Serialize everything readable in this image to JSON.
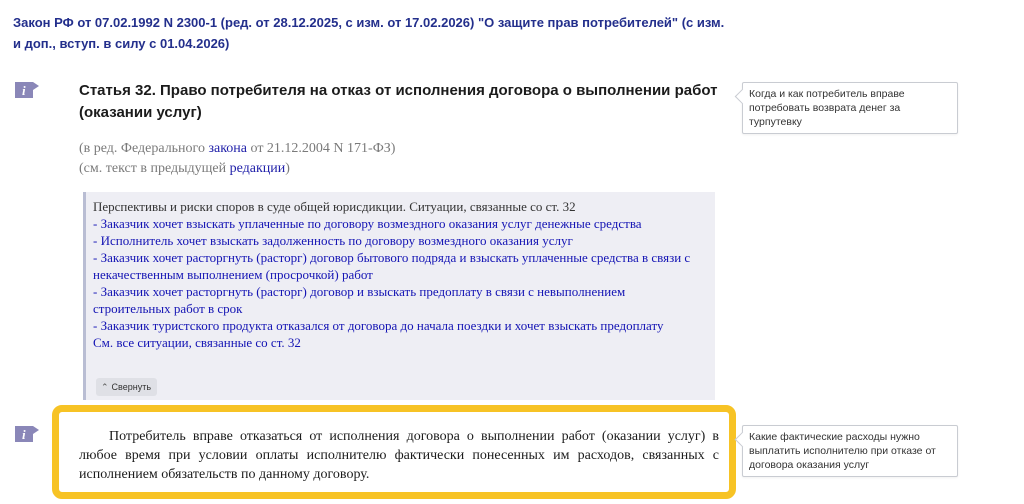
{
  "document": {
    "title": "Закон РФ от 07.02.1992 N 2300-1 (ред. от 28.12.2025, с изм. от 17.02.2026) \"О защите прав потребителей\" (с изм. и доп., вступ. в силу с 01.04.2026)"
  },
  "article": {
    "title": "Статья 32. Право потребителя на отказ от исполнения договора о выполнении работ (оказании услуг)",
    "edition_line1_prefix": "(в ред. Федерального ",
    "edition_line1_link": "закона",
    "edition_line1_suffix": " от 21.12.2004 N 171-ФЗ)",
    "edition_line2_prefix": "(см. текст в предыдущей ",
    "edition_line2_link": "редакции",
    "edition_line2_suffix": ")"
  },
  "side_notes": {
    "note1": "Когда и как потребитель вправе потребовать возврата денег за турпутевку",
    "note2": "Какие фактические расходы нужно выплатить исполнителю при отказе от договора оказания услуг"
  },
  "situations": {
    "heading": "Перспективы и риски споров в суде общей юрисдикции. Ситуации, связанные со ст. 32",
    "items": [
      "- Заказчик хочет взыскать уплаченные по договору возмездного оказания услуг денежные средства",
      "- Исполнитель хочет взыскать задолженность по договору возмездного оказания услуг",
      "- Заказчик хочет расторгнуть (расторг) договор бытового подряда и взыскать уплаченные средства в связи с некачественным выполнением (просрочкой) работ",
      "- Заказчик хочет расторгнуть (расторг) договор и взыскать предоплату в связи с невыполнением строительных работ в срок",
      "- Заказчик туристского продукта отказался от договора до начала поездки и хочет взыскать предоплату",
      "См. все ситуации, связанные со ст. 32"
    ],
    "collapse_label": "Свернуть"
  },
  "main_text": "Потребитель вправе отказаться от исполнения договора о выполнении работ (оказании услуг) в любое время при условии оплаты исполнителю фактически понесенных им расходов, связанных с исполнением обязательств по данному договору.",
  "colors": {
    "title_blue": "#232f8c",
    "link_blue": "#1414b4",
    "highlight_yellow": "#f7c325",
    "icon_purple": "#8a87b8"
  },
  "icons": [
    "info-icon"
  ]
}
